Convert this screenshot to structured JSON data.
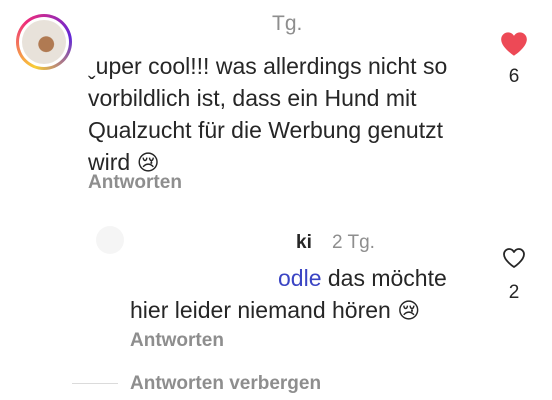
{
  "comments": [
    {
      "time": "Tg.",
      "text": "ˬuper cool!!! was allerdings nicht so vorbildlich ist, dass ein Hund mit Qualzucht für die Werbung genutzt wird",
      "emoji": "😢",
      "reply_label": "Antworten",
      "likes": "6",
      "liked": true,
      "heart_color": "#ed4956"
    },
    {
      "username": "ki",
      "time": "2 Tg.",
      "mention": "odle",
      "text_after_mention": " das möchte",
      "text_line2": "hier leider niemand hören",
      "emoji": "😢",
      "reply_label": "Antworten",
      "likes": "2",
      "liked": false
    }
  ],
  "hide_replies_label": "Antworten verbergen",
  "icons": {
    "like_filled": "heart-filled-icon",
    "like_outline": "heart-outline-icon"
  }
}
